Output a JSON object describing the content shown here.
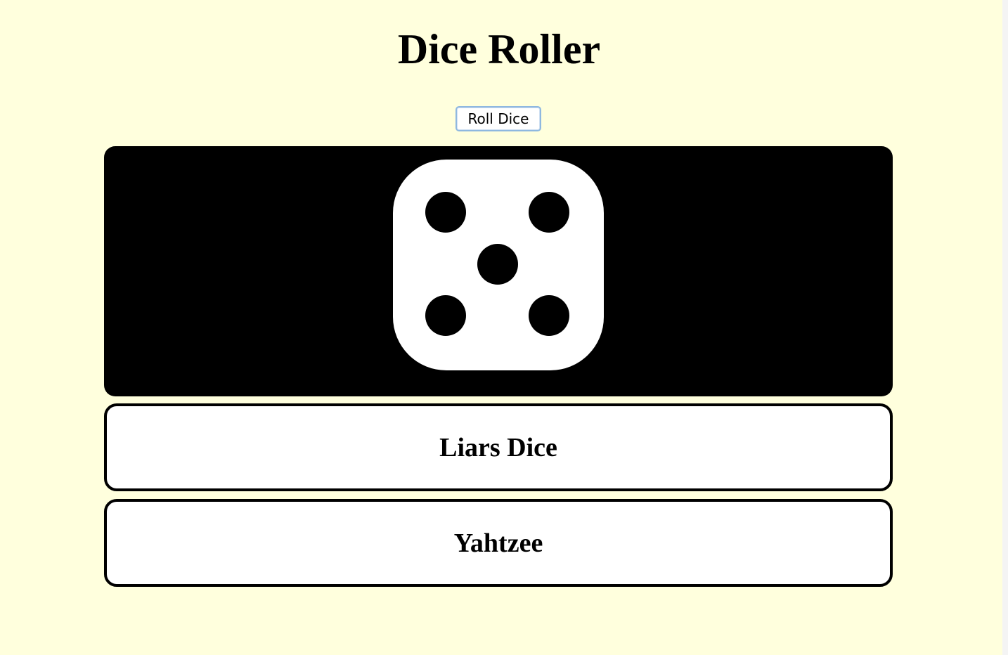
{
  "page": {
    "title": "Dice Roller",
    "background_color": "#ffffdd"
  },
  "controls": {
    "roll_button_label": "Roll Dice",
    "roll_button_border_color": "#8fb8e0"
  },
  "dice": {
    "current_value": 5,
    "face_color": "#ffffff",
    "pip_color": "#000000",
    "icon": "die-five-icon"
  },
  "games": [
    {
      "label": "Liars Dice"
    },
    {
      "label": "Yahtzee"
    }
  ]
}
